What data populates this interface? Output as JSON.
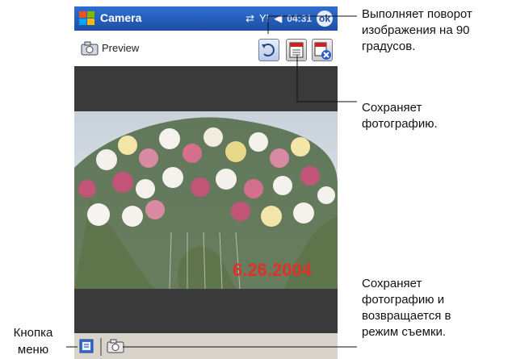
{
  "titlebar": {
    "title": "Camera",
    "time": "04:31",
    "ok_label": "ok"
  },
  "toolbar": {
    "preview_label": "Preview"
  },
  "photo": {
    "date_stamp": "6.26.2004"
  },
  "annotations": {
    "rotate": [
      "Выполняет поворот",
      "изображения на 90",
      "градусов."
    ],
    "save": [
      "Сохраняет",
      "фотографию."
    ],
    "save_return": [
      "Сохраняет",
      "фотографию и",
      "возвращается в",
      "режим съемки."
    ],
    "menu_button": [
      "Кнопка",
      "меню"
    ]
  },
  "colors": {
    "titlebar": "#1d4fa6",
    "date_stamp": "#e0302a",
    "menubar": "#d8d4cc"
  }
}
